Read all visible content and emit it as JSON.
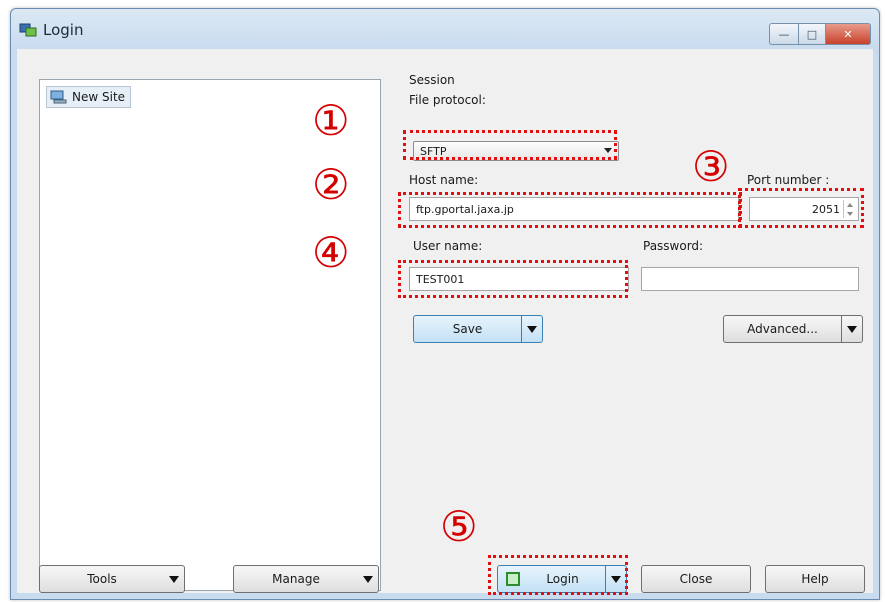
{
  "window": {
    "title": "Login",
    "title_icon": "app-icon",
    "controls": [
      "minimize",
      "maximize",
      "close"
    ]
  },
  "site_tree": {
    "items": [
      {
        "label": "New Site",
        "icon": "computer-icon"
      }
    ]
  },
  "session": {
    "group_label": "Session",
    "file_protocol": {
      "label": "File protocol:",
      "value": "SFTP"
    },
    "host_name": {
      "label": "Host name:",
      "value": "ftp.gportal.jaxa.jp"
    },
    "port_number": {
      "label": "Port number :",
      "value": "2051"
    },
    "user_name": {
      "label": "User name:",
      "value": "TEST001"
    },
    "password": {
      "label": "Password:",
      "value": ""
    },
    "save_button": "Save",
    "advanced_button": "Advanced..."
  },
  "bottom_buttons": {
    "tools": "Tools",
    "manage": "Manage",
    "login": "Login",
    "close": "Close",
    "help": "Help"
  },
  "annotations": {
    "marker_1": "①",
    "marker_2": "②",
    "marker_3": "③",
    "marker_4": "④",
    "marker_5": "⑤",
    "highlight_color": "#e01010"
  }
}
